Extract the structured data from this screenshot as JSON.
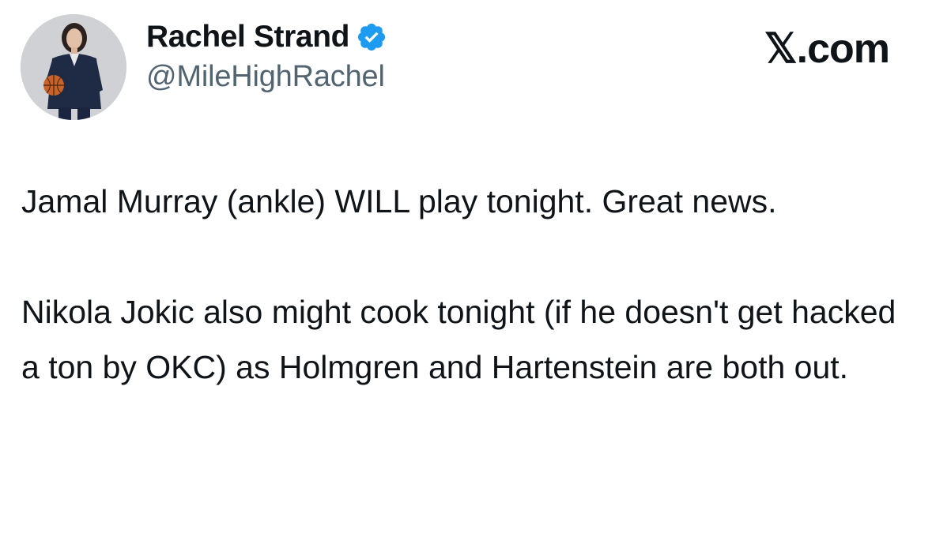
{
  "author": {
    "display_name": "Rachel Strand",
    "handle": "@MileHighRachel",
    "verified": true,
    "avatar_icon": "profile-photo-holding-basketball"
  },
  "site": {
    "label": "𝕏.com"
  },
  "tweet": {
    "paragraph_1": "Jamal Murray (ankle) WILL play tonight. Great news.",
    "paragraph_2": "Nikola Jokic also might cook tonight (if he doesn't get hacked a ton by OKC) as Holmgren and Hartenstein are both out."
  },
  "colors": {
    "text": "#0f1419",
    "secondary_text": "#536471",
    "verified_badge": "#1d9bf0",
    "background": "#ffffff"
  }
}
